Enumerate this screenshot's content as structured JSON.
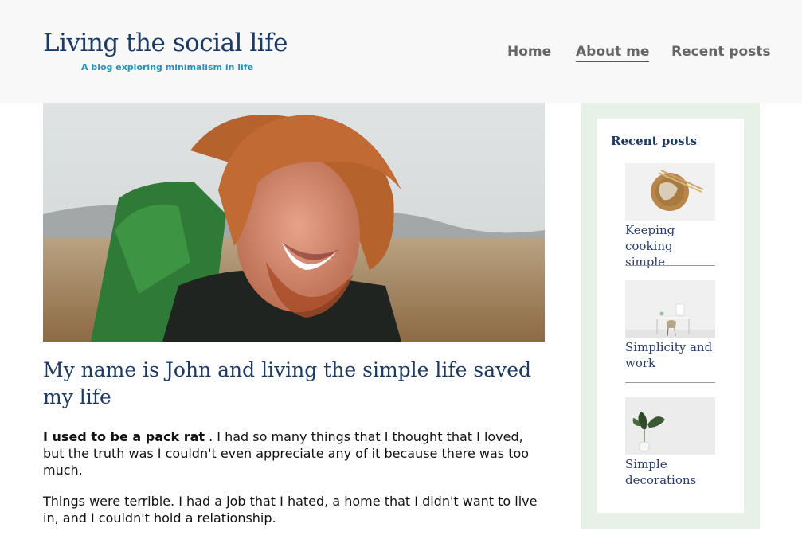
{
  "header": {
    "site_title": "Living the social life",
    "site_subtitle": "A blog exploring minimalism in life"
  },
  "nav": {
    "items": [
      {
        "label": "Home",
        "active": false
      },
      {
        "label": "About me",
        "active": true
      },
      {
        "label": "Recent posts",
        "active": false
      }
    ]
  },
  "main": {
    "post_title": "My name is John and living the simple life saved my life",
    "p1_strong": "I used to be a pack rat",
    "p1_rest": " . I had so many things that I thought that I loved, but the truth was I couldn't even appreciate any of it because there was too much.",
    "p2": "Things were terrible. I had a job that I hated, a home that I didn't want to live in, and I couldn't hold a relationship."
  },
  "sidebar": {
    "heading": "Recent posts",
    "posts": [
      {
        "title": "Keeping cooking simple",
        "thumb": "woven-bowl-chopsticks-photo"
      },
      {
        "title": "Simplicity and work",
        "thumb": "white-desk-chair-photo"
      },
      {
        "title": "Simple decorations",
        "thumb": "plant-vase-photo"
      }
    ]
  },
  "colors": {
    "title_blue": "#1d3a63",
    "subtitle_blue": "#2b8fb8",
    "sidebar_green": "#e8f1e8",
    "header_bg": "#f8f8f8"
  }
}
